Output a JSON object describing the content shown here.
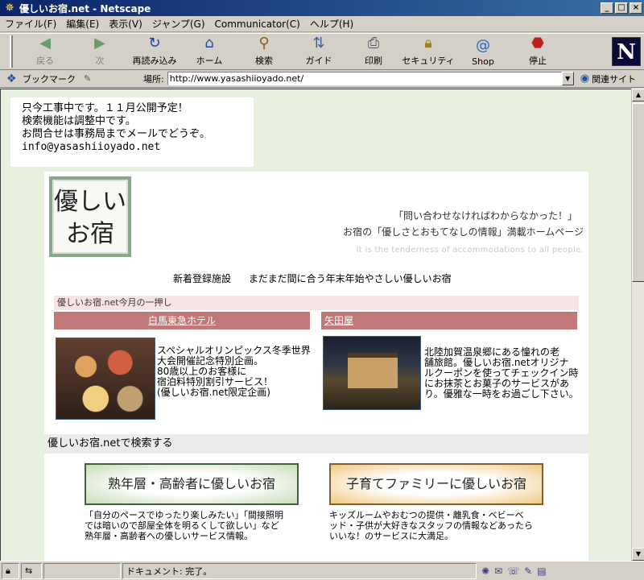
{
  "window": {
    "title": "優しいお宿.net - Netscape",
    "app_icon": "netscape-star-icon"
  },
  "menu": [
    "ファイル(F)",
    "編集(E)",
    "表示(V)",
    "ジャンプ(G)",
    "Communicator(C)",
    "ヘルプ(H)"
  ],
  "toolbar": {
    "buttons": [
      {
        "label": "戻る",
        "icon": "back-arrow-icon",
        "enabled": false
      },
      {
        "label": "次",
        "icon": "forward-arrow-icon",
        "enabled": false
      },
      {
        "label": "再読み込み",
        "icon": "reload-icon",
        "enabled": true
      },
      {
        "label": "ホーム",
        "icon": "home-icon",
        "enabled": true
      },
      {
        "label": "検索",
        "icon": "search-icon",
        "enabled": true
      },
      {
        "label": "ガイド",
        "icon": "guide-icon",
        "enabled": true
      },
      {
        "label": "印刷",
        "icon": "print-icon",
        "enabled": true
      },
      {
        "label": "セキュリティ",
        "icon": "lock-icon",
        "enabled": true
      },
      {
        "label": "Shop",
        "icon": "shop-icon",
        "enabled": true
      },
      {
        "label": "停止",
        "icon": "stop-icon",
        "enabled": true
      }
    ],
    "logo": "N"
  },
  "location": {
    "bookmark_label": "ブックマーク",
    "location_label": "場所:",
    "url": "http://www.yasashiioyado.net/",
    "related_label": "関連サイト"
  },
  "notice": {
    "lines": [
      "只今工事中です。１１月公開予定！",
      "検索機能は調整中です。",
      "お問合せは事務局までメールでどうぞ。",
      "info@yasashiioyado.net"
    ]
  },
  "header": {
    "logo_line1": "優しい",
    "logo_line2": "お宿",
    "tagline1": "「問い合わせなければわからなかった！」",
    "tagline2": "お宿の「優しさとおもてなしの情報」満載ホームページ",
    "tagline_en": "It is the tenderness of accommodations to all people."
  },
  "new_links": [
    "新着登録施設",
    "まだまだ間に合う年末年始やさしい優しいお宿"
  ],
  "pick": {
    "header": "優しいお宿.net今月の一押し",
    "left": {
      "name": "白馬東急ホテル",
      "desc": [
        "スペシャルオリンピックス冬季世界",
        "大会開催記念特別企画。",
        "80歳以上のお客様に",
        "宿泊料特別割引サービス！",
        "(優しいお宿.net限定企画)"
      ]
    },
    "right": {
      "name": "矢田屋",
      "desc": [
        "北陸加賀温泉郷にある憧れの老",
        "舗旅館。優しいお宿.netオリジナ",
        "ルクーポンを使ってチェックイン時",
        "にお抹茶とお菓子のサービスがあ",
        "り。優雅な一時をお過ごし下さい。"
      ]
    }
  },
  "search": {
    "heading": "優しいお宿.netで検索する",
    "senior": {
      "label": "熟年層・高齢者に優しいお宿",
      "desc": [
        "「自分のペースでゆったり楽しみたい」「間接照明",
        "では暗いので部屋全体を明るくして欲しい」など",
        "熟年層・高齢者への優しいサービス情報。"
      ]
    },
    "family": {
      "label": "子育てファミリーに優しいお宿",
      "desc": [
        "キッズルームやおむつの提供・離乳食・ベビーベ",
        "ッド・子供が大好きなスタッフの情報などあったら",
        "いいな！のサービスに大満足。"
      ]
    }
  },
  "status": {
    "text": "ドキュメント: 完了。"
  }
}
